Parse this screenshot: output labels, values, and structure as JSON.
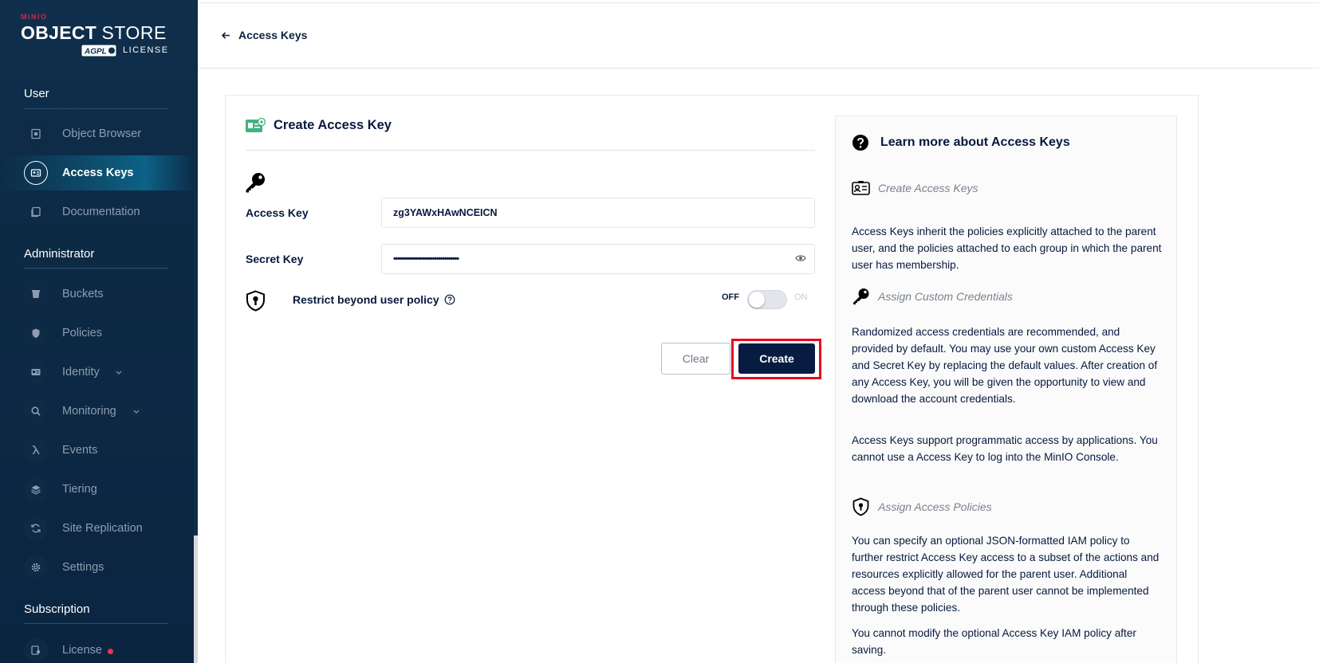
{
  "logo": {
    "minio": "MINIO",
    "brand_bold": "OBJECT",
    "brand_light": "STORE",
    "agpl": "AGPL",
    "license": "LICENSE"
  },
  "sidebar": {
    "sections": [
      {
        "title": "User",
        "items": [
          {
            "label": "Object Browser",
            "icon": "object-browser-icon",
            "active": false
          },
          {
            "label": "Access Keys",
            "icon": "access-keys-icon",
            "active": true
          },
          {
            "label": "Documentation",
            "icon": "documentation-icon",
            "active": false
          }
        ]
      },
      {
        "title": "Administrator",
        "items": [
          {
            "label": "Buckets",
            "icon": "buckets-icon"
          },
          {
            "label": "Policies",
            "icon": "policies-icon"
          },
          {
            "label": "Identity",
            "icon": "identity-icon",
            "expandable": true
          },
          {
            "label": "Monitoring",
            "icon": "monitoring-icon",
            "expandable": true
          },
          {
            "label": "Events",
            "icon": "lambda-icon"
          },
          {
            "label": "Tiering",
            "icon": "tiering-icon"
          },
          {
            "label": "Site Replication",
            "icon": "site-replication-icon"
          },
          {
            "label": "Settings",
            "icon": "settings-icon"
          }
        ]
      },
      {
        "title": "Subscription",
        "items": [
          {
            "label": "License",
            "icon": "license-icon",
            "badge": "red-dot"
          }
        ]
      }
    ]
  },
  "header": {
    "back_label": "Access Keys"
  },
  "form": {
    "title": "Create Access Key",
    "access_key_label": "Access Key",
    "access_key_value": "zg3YAWxHAwNCEICN",
    "secret_key_label": "Secret Key",
    "secret_key_value": "••••••••••••••••••••••••••••••••",
    "restrict_label": "Restrict beyond user policy",
    "toggle_off": "OFF",
    "toggle_on": "ON",
    "toggle_state": false,
    "clear_label": "Clear",
    "create_label": "Create"
  },
  "help": {
    "title": "Learn more about Access Keys",
    "sections": [
      {
        "heading": "Create Access Keys",
        "paragraphs": [
          "Access Keys inherit the policies explicitly attached to the parent user, and the policies attached to each group in which the parent user has membership."
        ]
      },
      {
        "heading": "Assign Custom Credentials",
        "paragraphs": [
          "Randomized access credentials are recommended, and provided by default. You may use your own custom Access Key and Secret Key by replacing the default values. After creation of any Access Key, you will be given the opportunity to view and download the account credentials.",
          "Access Keys support programmatic access by applications. You cannot use a Access Key to log into the MinIO Console."
        ]
      },
      {
        "heading": "Assign Access Policies",
        "paragraphs": [
          "You can specify an optional JSON-formatted IAM policy to further restrict Access Key access to a subset of the actions and resources explicitly allowed for the parent user. Additional access beyond that of the parent user cannot be implemented through these policies.",
          "You cannot modify the optional Access Key IAM policy after saving."
        ]
      }
    ]
  },
  "colors": {
    "sidebar_bg": "#0f2f4d",
    "primary": "#081c42",
    "highlight_outline": "#e8071b",
    "badge": "#e8374a"
  }
}
